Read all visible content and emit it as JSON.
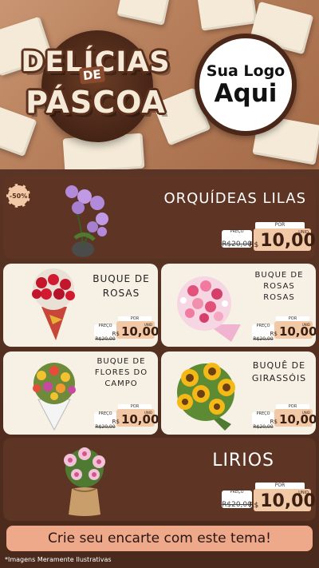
{
  "header": {
    "title_line1": "DELÍCIAS",
    "title_de": "DE",
    "title_line2": "PÁSCOA",
    "logo_line1": "Sua Logo",
    "logo_line2": "Aqui"
  },
  "badge": {
    "label": "-50%"
  },
  "products": [
    {
      "name": "ORQUÍDEAS LILAS",
      "price_label": "PREÇO",
      "old_price": "R$20,00",
      "por_label": "POR",
      "currency": "R$",
      "new_price": "10,00",
      "unit": "UNID"
    },
    {
      "name": "BUQUE DE ROSAS",
      "price_label": "PREÇO",
      "old_price": "R$20,00",
      "por_label": "POR",
      "currency": "R$",
      "new_price": "10,00",
      "unit": "UNID"
    },
    {
      "name": "BUQUE DE ROSAS ROSAS",
      "price_label": "PREÇO",
      "old_price": "R$20,00",
      "por_label": "POR",
      "currency": "R$",
      "new_price": "10,00",
      "unit": "UNID"
    },
    {
      "name": "BUQUE DE FLORES DO CAMPO",
      "price_label": "PREÇO",
      "old_price": "R$20,00",
      "por_label": "POR",
      "currency": "R$",
      "new_price": "10,00",
      "unit": "UNID"
    },
    {
      "name": "BUQUÊ DE GIRASSÓIS",
      "price_label": "PREÇO",
      "old_price": "R$20,00",
      "por_label": "POR",
      "currency": "R$",
      "new_price": "10,00",
      "unit": "UNID"
    },
    {
      "name": "LIRIOS",
      "price_label": "PREÇO",
      "old_price": "R$20,00",
      "por_label": "POR",
      "currency": "R$",
      "new_price": "10,00",
      "unit": "UNID"
    }
  ],
  "cta": {
    "label": "Crie seu encarte com este tema!"
  },
  "footer": {
    "disclaimer": "*Imagens Meramente Ilustrativas"
  }
}
